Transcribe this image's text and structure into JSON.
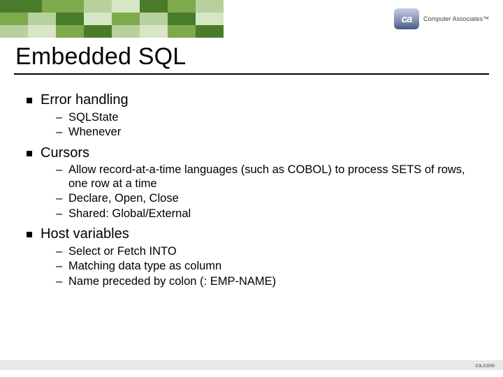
{
  "logo": {
    "mark": "ca",
    "text": "Computer Associates™"
  },
  "title": "Embedded SQL",
  "sections": [
    {
      "heading": "Error handling",
      "items": [
        "SQLState",
        "Whenever"
      ]
    },
    {
      "heading": "Cursors",
      "items": [
        "Allow record-at-a-time languages (such as COBOL) to process SETS of rows, one row at a time",
        "Declare, Open, Close",
        "Shared: Global/External"
      ]
    },
    {
      "heading": "Host variables",
      "items": [
        "Select or Fetch INTO",
        "Matching data type as column",
        "Name preceded by colon (: EMP-NAME)"
      ]
    }
  ],
  "footer": "ca.com"
}
